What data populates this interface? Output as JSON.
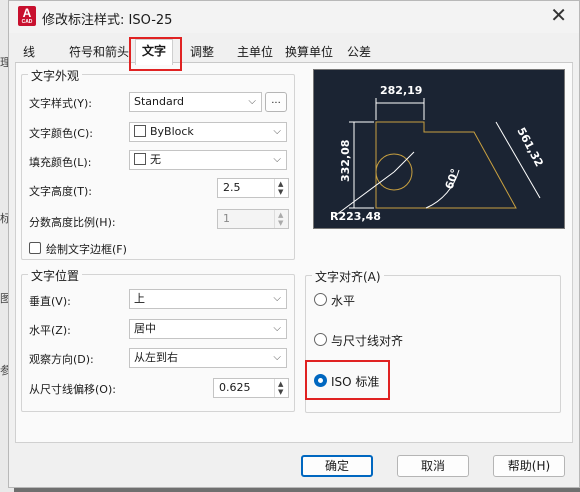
{
  "window": {
    "title": "修改标注样式: ISO-25",
    "app_icon_letter": "A",
    "app_icon_sub": "CAD"
  },
  "side_strip": [
    "理",
    "标",
    "图",
    "参"
  ],
  "tabs": [
    "线",
    "符号和箭头",
    "文字",
    "调整",
    "主单位",
    "换算单位",
    "公差"
  ],
  "active_tab": "文字",
  "text_appearance": {
    "group_label": "文字外观",
    "style_label": "文字样式(Y):",
    "style_value": "Standard",
    "style_more": "...",
    "color_label": "文字颜色(C):",
    "color_value": "ByBlock",
    "fill_label": "填充颜色(L):",
    "fill_value": "无",
    "height_label": "文字高度(T):",
    "height_value": "2.5",
    "fraction_label": "分数高度比例(H):",
    "fraction_value": "1",
    "frame_label": "绘制文字边框(F)"
  },
  "text_placement": {
    "group_label": "文字位置",
    "vertical_label": "垂直(V):",
    "vertical_value": "上",
    "horizontal_label": "水平(Z):",
    "horizontal_value": "居中",
    "direction_label": "观察方向(D):",
    "direction_value": "从左到右",
    "offset_label": "从尺寸线偏移(O):",
    "offset_value": "0.625"
  },
  "text_alignment": {
    "group_label": "文字对齐(A)",
    "options": [
      "水平",
      "与尺寸线对齐",
      "ISO 标准"
    ],
    "selected": "ISO 标准"
  },
  "preview": {
    "dim_top": "282,19",
    "dim_left": "332,08",
    "dim_diag": "561,32",
    "angle": "60°",
    "radius": "R223,48"
  },
  "buttons": {
    "ok": "确定",
    "cancel": "取消",
    "help": "帮助(H)"
  },
  "colors": {
    "highlight": "#e02222",
    "accent": "#0067c0",
    "preview_bg": "#1b2433",
    "preview_shape": "#c8a040"
  }
}
